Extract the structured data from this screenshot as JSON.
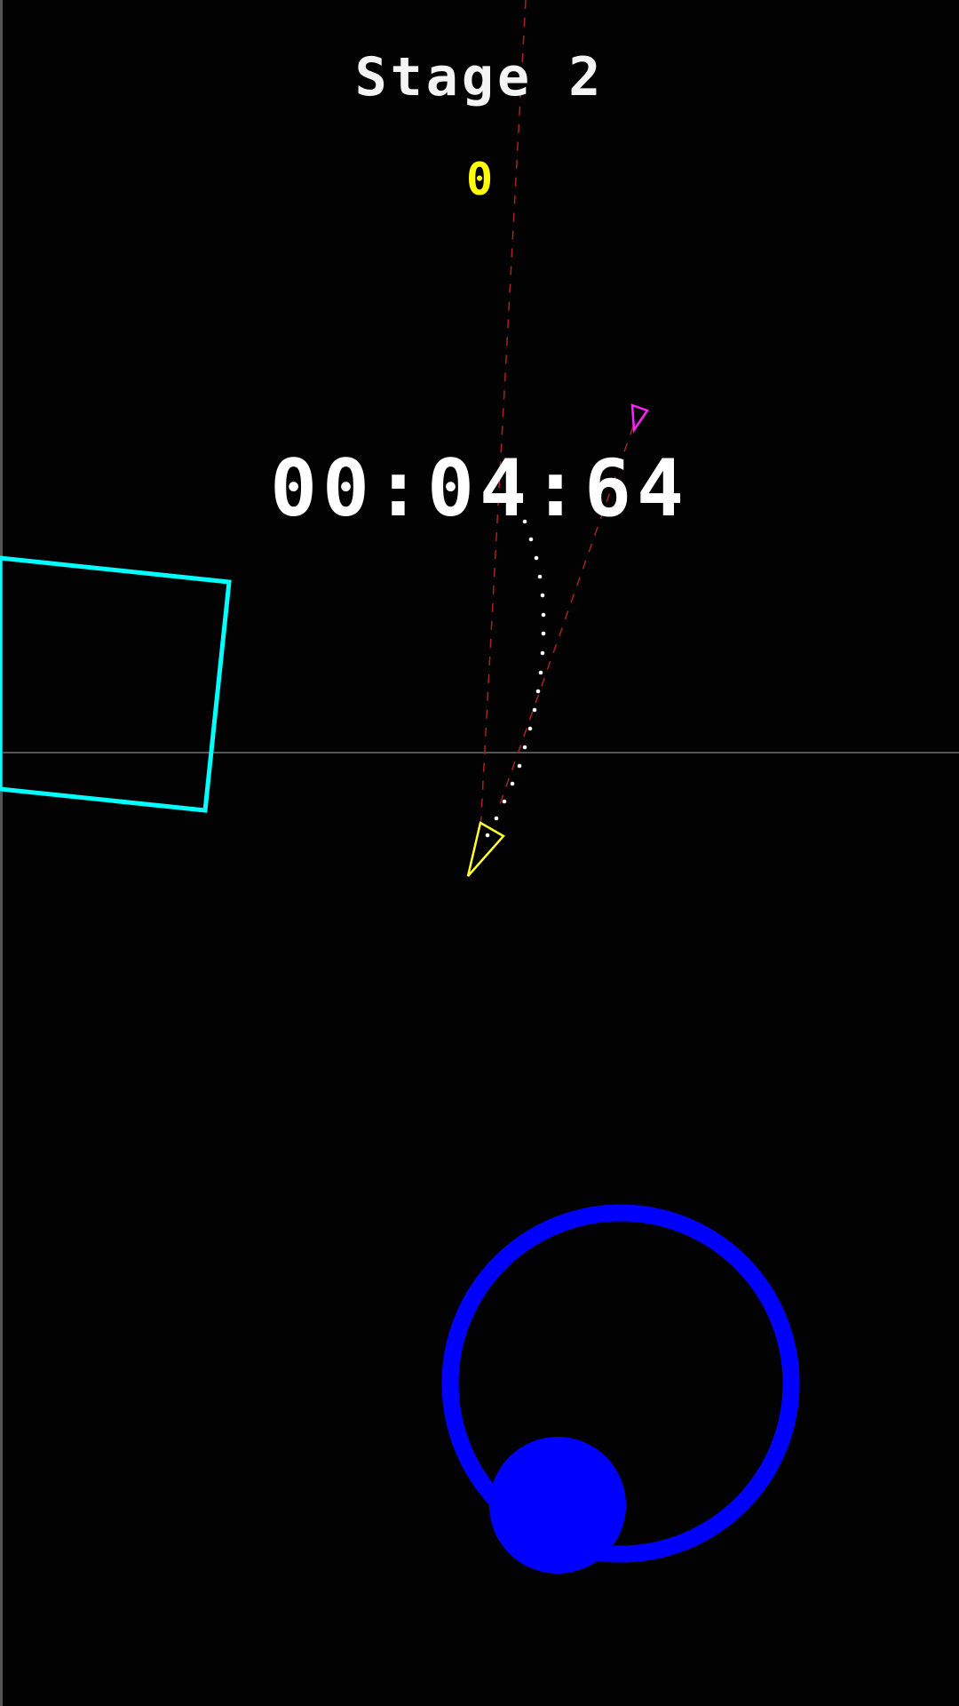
{
  "hud": {
    "stage_label": "Stage 2",
    "score": "0",
    "timer": "00:04:64"
  },
  "colors": {
    "background": "#020203",
    "player_ship": "#ffff33",
    "enemy_ship": "#ff22ff",
    "obstacle": "#00ffff",
    "joystick": "#0000ff",
    "trajectory_dots": "#ffffff",
    "aim_line": "#aa2222",
    "divider": "#555555",
    "score": "#ffff00"
  },
  "icons": {
    "player": "player-ship-icon",
    "enemy": "enemy-ship-icon",
    "obstacle": "rotating-square-obstacle",
    "joystick_ring": "joystick-ring",
    "joystick_knob": "joystick-knob"
  }
}
